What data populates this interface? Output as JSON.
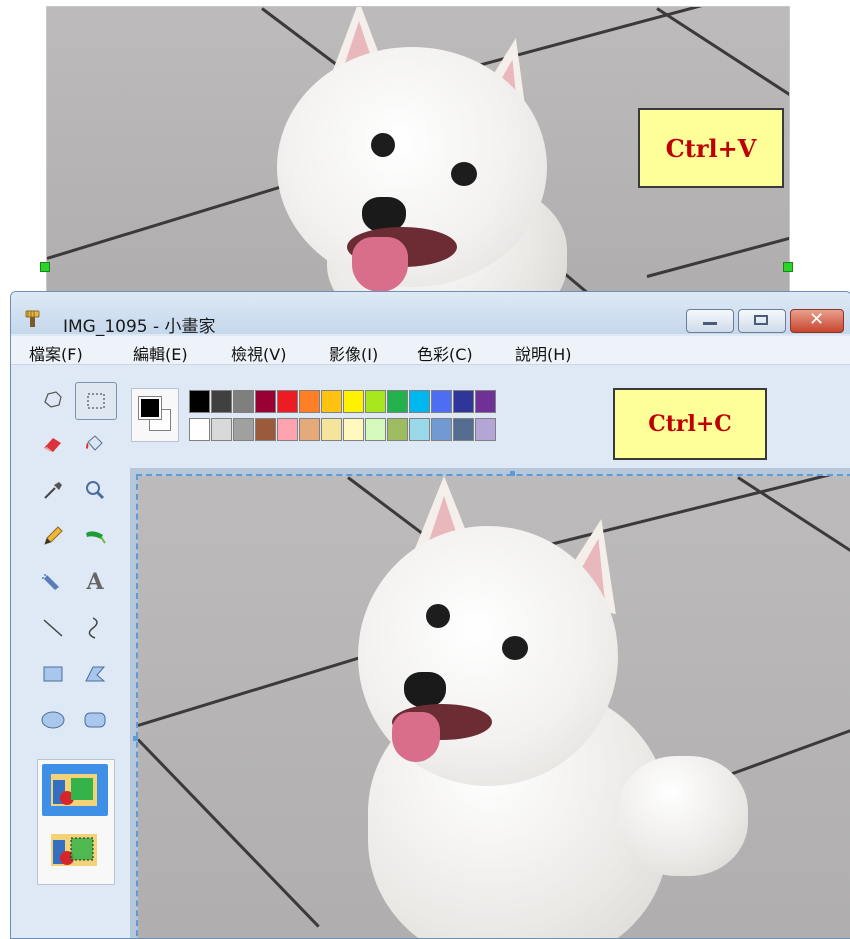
{
  "annotations": {
    "paste_label": "Ctrl+V",
    "copy_label": "Ctrl+C"
  },
  "window": {
    "title": "IMG_1095 - 小畫家",
    "minimize_icon": "minimize-icon",
    "maximize_icon": "maximize-icon",
    "close_icon": "close-icon"
  },
  "menu": {
    "items": [
      "檔案(F)",
      "編輯(E)",
      "檢視(V)",
      "影像(I)",
      "色彩(C)",
      "說明(H)"
    ]
  },
  "tools": [
    {
      "name": "free-form-select",
      "glyph": "⬠"
    },
    {
      "name": "rectangle-select",
      "glyph": "⬚"
    },
    {
      "name": "eraser",
      "glyph": "◆"
    },
    {
      "name": "fill",
      "glyph": "◈"
    },
    {
      "name": "color-picker",
      "glyph": "✒"
    },
    {
      "name": "magnifier",
      "glyph": "🔍"
    },
    {
      "name": "pencil",
      "glyph": "✎"
    },
    {
      "name": "brush",
      "glyph": "✐"
    },
    {
      "name": "airbrush",
      "glyph": "✈"
    },
    {
      "name": "text",
      "glyph": "A"
    },
    {
      "name": "line",
      "glyph": "╲"
    },
    {
      "name": "curve",
      "glyph": "∫"
    },
    {
      "name": "rectangle",
      "glyph": "▭"
    },
    {
      "name": "polygon",
      "glyph": "⏢"
    },
    {
      "name": "ellipse",
      "glyph": "⬭"
    },
    {
      "name": "rounded-rectangle",
      "glyph": "▢"
    }
  ],
  "colors": {
    "foreground": "#000000",
    "background": "#ffffff",
    "row1": [
      "#000000",
      "#404040",
      "#7f7f7f",
      "#990033",
      "#ed1c24",
      "#ff7f27",
      "#ffc20e",
      "#fff200",
      "#a8e61d",
      "#22b14c",
      "#00b7ef",
      "#4d6df3",
      "#2f3699",
      "#6f3198"
    ],
    "row2": [
      "#ffffff",
      "#d9d9d9",
      "#a0a0a0",
      "#9c5a3c",
      "#ffa3b1",
      "#e5aa7a",
      "#f5e49c",
      "#fff9bd",
      "#d3f9bc",
      "#9dbb61",
      "#99d9ea",
      "#709ad1",
      "#546d8e",
      "#b5a5d5"
    ]
  },
  "accent": {
    "note_fill": "#ffff99",
    "note_text": "#c00000",
    "selection_handle": "#2bd32b",
    "selection_border": "#5c9ad8"
  }
}
